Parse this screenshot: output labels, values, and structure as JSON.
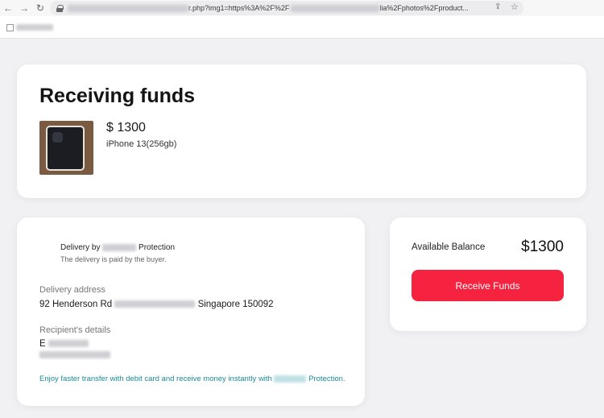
{
  "browser": {
    "url_visible": "r.php?img1=https%3A%2F%2F",
    "url_visible_tail": "lia%2Fphotos%2Fproduct..."
  },
  "page": {
    "title": "Receiving funds",
    "product": {
      "price": "$ 1300",
      "name": "iPhone 13(256gb)"
    }
  },
  "delivery": {
    "by_prefix": "Delivery by",
    "by_suffix": "Protection",
    "note": "The delivery is paid by the buyer.",
    "address_label": "Delivery address",
    "address_start": "92 Henderson Rd",
    "address_end": "Singapore 150092",
    "recipient_label": "Recipient's details",
    "recipient_initial": "E",
    "promo_prefix": "Enjoy faster transfer with debit card and receive money instantly with",
    "promo_suffix": "Protection."
  },
  "balance": {
    "label": "Available Balance",
    "value": "$1300",
    "button_label": "Receive Funds"
  },
  "colors": {
    "accent": "#f5233f",
    "promo_text": "#1b8a96",
    "background": "#f1f1f4"
  },
  "icons": [
    "back-icon",
    "forward-icon",
    "reload-icon",
    "lock-icon",
    "share-icon",
    "star-icon",
    "broken-image-icon"
  ]
}
